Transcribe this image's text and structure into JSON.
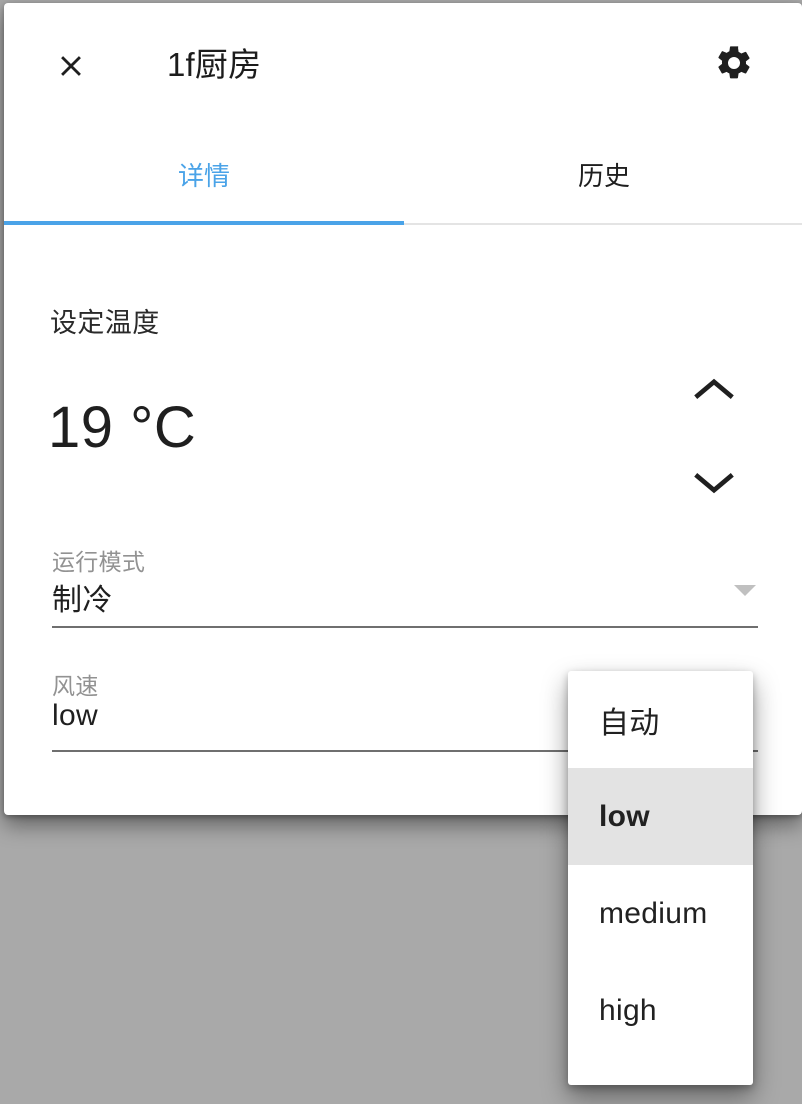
{
  "window": {
    "background_color": "#a9a9a9",
    "card_background": "#ffffff"
  },
  "header": {
    "close_icon": "close-icon",
    "title": "1f厨房",
    "settings_icon": "gear-icon"
  },
  "tabs": {
    "accent_color": "#4aa3e8",
    "items": [
      {
        "label": "详情",
        "active": true
      },
      {
        "label": "历史",
        "active": false
      }
    ]
  },
  "detail": {
    "setpoint": {
      "label": "设定温度",
      "value": "19 °C",
      "increment_icon": "chevron-up-icon",
      "decrement_icon": "chevron-down-icon"
    },
    "mode": {
      "label": "运行模式",
      "value": "制冷",
      "caret_icon": "dropdown-caret-icon"
    },
    "fan_speed": {
      "label": "风速",
      "value": "low",
      "caret_icon": "dropdown-caret-icon"
    }
  },
  "fan_menu": {
    "open": true,
    "selected": "low",
    "highlight_color": "#e3e3e3",
    "options": [
      {
        "label": "自动",
        "selected": false
      },
      {
        "label": "low",
        "selected": true
      },
      {
        "label": "medium",
        "selected": false
      },
      {
        "label": "high",
        "selected": false
      }
    ]
  }
}
